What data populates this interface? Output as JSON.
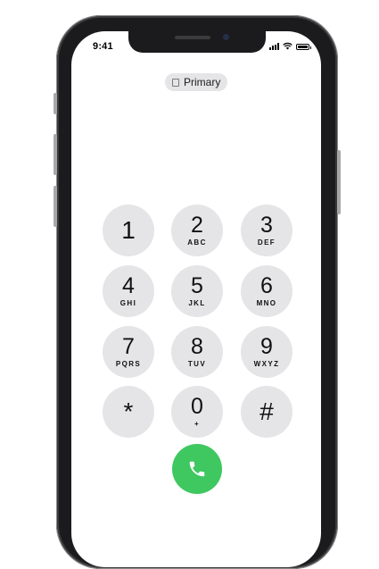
{
  "status_bar": {
    "time": "9:41",
    "icons": [
      "cellular-signal-icon",
      "wifi-icon",
      "battery-icon"
    ]
  },
  "line_selector": {
    "icon": "sim-card-icon",
    "label": "Primary"
  },
  "keypad": {
    "keys": [
      {
        "digit": "1",
        "letters": ""
      },
      {
        "digit": "2",
        "letters": "ABC"
      },
      {
        "digit": "3",
        "letters": "DEF"
      },
      {
        "digit": "4",
        "letters": "GHI"
      },
      {
        "digit": "5",
        "letters": "JKL"
      },
      {
        "digit": "6",
        "letters": "MNO"
      },
      {
        "digit": "7",
        "letters": "PQRS"
      },
      {
        "digit": "8",
        "letters": "TUV"
      },
      {
        "digit": "9",
        "letters": "WXYZ"
      },
      {
        "digit": "*",
        "letters": ""
      },
      {
        "digit": "0",
        "letters": "+"
      },
      {
        "digit": "#",
        "letters": ""
      }
    ]
  },
  "call_button": {
    "icon": "phone-icon",
    "color": "#3fc760"
  },
  "colors": {
    "key_background": "#e5e5e7",
    "device_frame": "#1b1b1d"
  }
}
